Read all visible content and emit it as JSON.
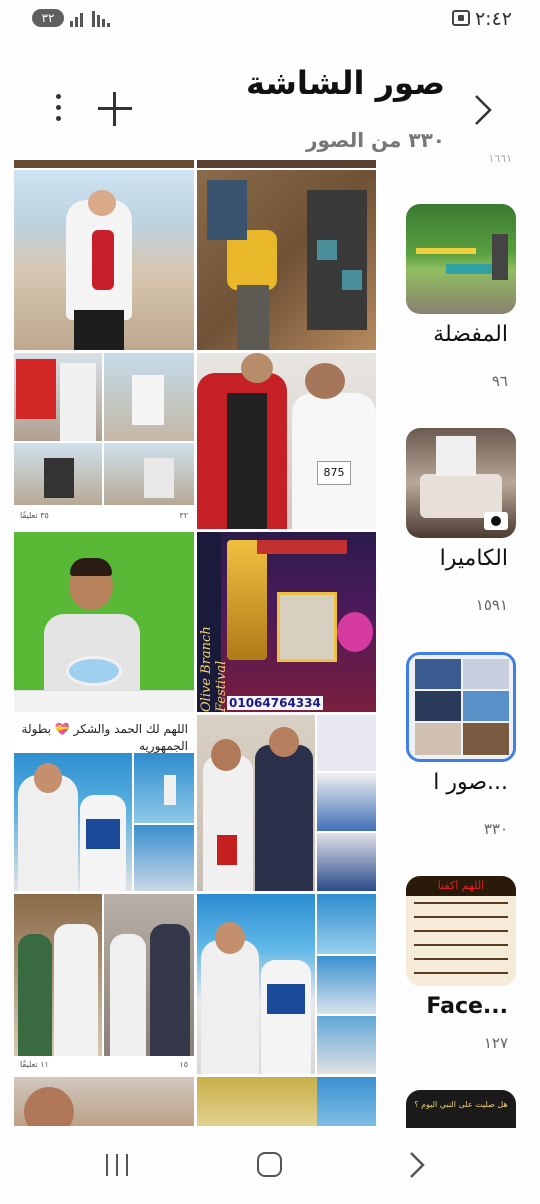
{
  "status_bar": {
    "time": "٢:٤٢",
    "battery": "٣٢"
  },
  "header": {
    "title": "صور الشاشة",
    "subtitle": "٣٣٠ من الصور"
  },
  "grid": {
    "post1_comments": "٣٥ تعليقًا",
    "post1_reactions": "٣٢",
    "post2_caption": "اللهم لك الحمد والشكر 💝 بطولة الجمهوريه",
    "post2_comments": "١١ تعليقًا",
    "post2_reactions": "١٥",
    "poster_side_text": "Olive Branch Festival",
    "poster_phone": "01064764334"
  },
  "side": {
    "top_count": "١٦٦١",
    "albums": [
      {
        "name": "المفضلة",
        "count": "٩٦"
      },
      {
        "name": "الكاميرا",
        "count": "١٥٩١"
      },
      {
        "name": "صور ا...",
        "count": "٣٣٠"
      },
      {
        "name": "Face...",
        "count": "١٢٧"
      }
    ],
    "album4_thumb_text": "اللهم اكفنا",
    "album5_thumb_text": "هل صليت على النبي اليوم ؟"
  },
  "colors": {
    "selected_border": "#3e7ee8",
    "text_primary": "#111111",
    "text_secondary": "#777777"
  }
}
